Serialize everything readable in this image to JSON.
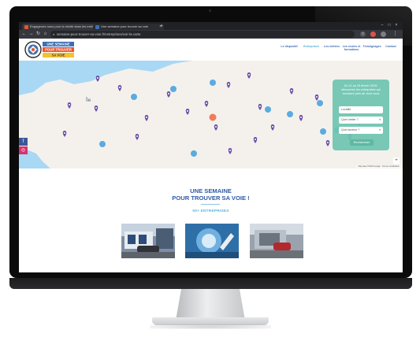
{
  "browser": {
    "tabs": [
      {
        "label": "Engageons-nous pour la mixité dans les métiers",
        "favicon_color": "#e8542f"
      },
      {
        "label": "Une semaine pour trouver sa voie",
        "favicon_color": "#3f6db3"
      }
    ],
    "new_tab": "+",
    "url": "semaine-pour-trouver-sa-voie.fr/entreprises/voir-la-carte",
    "window_controls": [
      "–",
      "□",
      "×"
    ]
  },
  "site": {
    "logo_text": [
      "UNE SEMAINE",
      "POUR TROUVER",
      "SA VOIE"
    ],
    "nav": [
      {
        "label": "Le dispositif",
        "active": false
      },
      {
        "label": "Entreprises",
        "active": true
      },
      {
        "label": "Les métiers",
        "active": false
      },
      {
        "label": "Les écoles et formations",
        "active": false
      },
      {
        "label": "Témoignages",
        "active": false
      },
      {
        "label": "Contact",
        "active": false
      }
    ]
  },
  "map": {
    "panel_title": "Du 11 au 15 février 2019, découvrez les entreprises qui recrutent près de chez vous",
    "selects": [
      "Localité",
      "Quel métier ?",
      "Quel secteur ?"
    ],
    "search_button": "Rechercher",
    "attribution": "Map data ©2019 Google · Termes d'utilisation",
    "zoom_label": "+",
    "land_label": "Île",
    "social": [
      "f",
      "◎"
    ],
    "colors": {
      "sea": "#a9d8f4",
      "land": "#f4f1ec",
      "pin": "#6a4ea8",
      "cluster": "#4aa3df",
      "highlight": "#f07c5a"
    }
  },
  "section": {
    "title_line1": "UNE SEMAINE",
    "title_line2": "POUR TROUVER SA VOIE !",
    "subtitle": "50+ ENTREPRISES"
  }
}
